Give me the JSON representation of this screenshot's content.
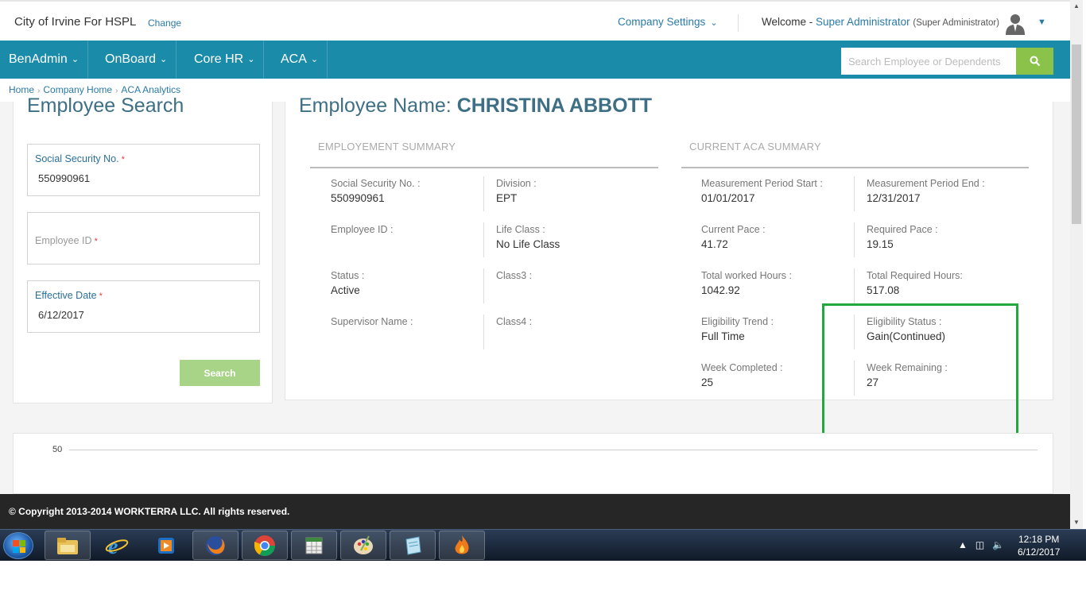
{
  "header": {
    "company_name": "City of Irvine For HSPL",
    "change_label": "Change",
    "company_settings_label": "Company Settings",
    "welcome_prefix": "Welcome -",
    "user_name": "Super Administrator",
    "user_role": "(Super Administrator)"
  },
  "nav": {
    "items": [
      {
        "label": "BenAdmin"
      },
      {
        "label": "OnBoard"
      },
      {
        "label": "Core HR"
      },
      {
        "label": "ACA"
      }
    ],
    "search_placeholder": "Search Employee or Dependents"
  },
  "breadcrumb": [
    "Home",
    "Company Home",
    "ACA Analytics"
  ],
  "employee_search": {
    "title": "Employee Search",
    "ssn_label": "Social Security No.",
    "ssn_value": "550990961",
    "employee_id_label": "Employee ID",
    "effective_date_label": "Effective Date",
    "effective_date_value": "6/12/2017",
    "search_button": "Search",
    "required_mark": "*"
  },
  "employee": {
    "name_prefix": "Employee Name:",
    "name": "CHRISTINA ABBOTT"
  },
  "employment_summary": {
    "heading": "EMPLOYEMENT SUMMARY",
    "fields": [
      {
        "label": "Social Security No. :",
        "value": "550990961"
      },
      {
        "label": "Division :",
        "value": "EPT"
      },
      {
        "label": "Employee ID :",
        "value": ""
      },
      {
        "label": "Life Class :",
        "value": "No Life Class"
      },
      {
        "label": "Status :",
        "value": "Active"
      },
      {
        "label": "Class3 :",
        "value": ""
      },
      {
        "label": "Supervisor Name :",
        "value": ""
      },
      {
        "label": "Class4 :",
        "value": ""
      }
    ]
  },
  "aca_summary": {
    "heading": "CURRENT ACA SUMMARY",
    "fields": [
      {
        "label": "Measurement Period Start :",
        "value": "01/01/2017"
      },
      {
        "label": "Measurement Period End :",
        "value": "12/31/2017"
      },
      {
        "label": "Current Pace :",
        "value": "41.72"
      },
      {
        "label": "Required Pace :",
        "value": "19.15"
      },
      {
        "label": "Total worked Hours :",
        "value": "1042.92"
      },
      {
        "label": "Total Required Hours:",
        "value": "517.08"
      },
      {
        "label": "Eligibility Trend :",
        "value": "Full Time"
      },
      {
        "label": "Eligibility Status :",
        "value": "Gain(Continued)"
      },
      {
        "label": "Week Completed :",
        "value": "25"
      },
      {
        "label": "Week Remaining :",
        "value": "27"
      }
    ]
  },
  "chart": {
    "tick_label": "50"
  },
  "footer": {
    "copyright": "© Copyright 2013-2014 WORKTERRA LLC. All rights reserved."
  },
  "taskbar": {
    "apps": [
      "file-explorer-icon",
      "internet-explorer-icon",
      "media-player-icon",
      "firefox-icon",
      "chrome-icon",
      "spreadsheet-icon",
      "paint-icon",
      "notepad-icon",
      "app-flame-icon"
    ],
    "time": "12:18 PM",
    "date": "6/12/2017"
  },
  "colors": {
    "nav_bg": "#1a8ba9",
    "accent_green": "#8bc34a",
    "link_blue": "#2a7aa8",
    "highlight_green": "#22a83f"
  }
}
